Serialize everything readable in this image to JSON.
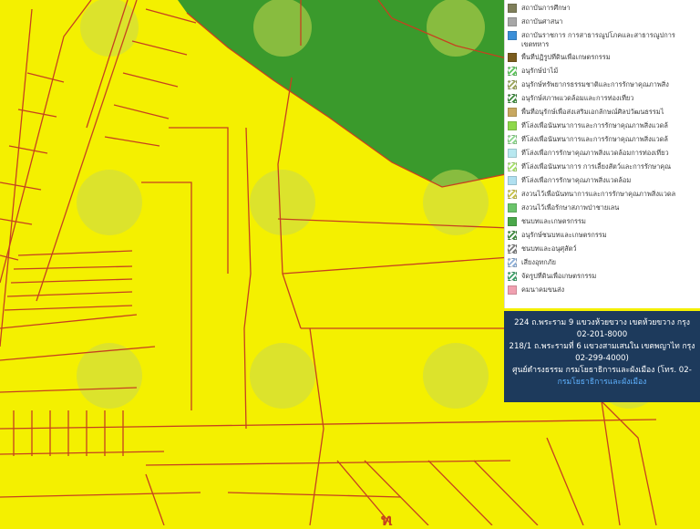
{
  "colors": {
    "zone_yellow": "#f4f000",
    "zone_green": "#3a9a2c",
    "parcel_line": "#c6411f",
    "watermark": "#c9d850",
    "info_bg": "#1d3a5c"
  },
  "legend": {
    "items": [
      {
        "label": "สถาบันการศึกษา",
        "swatch": "#7f7f5a",
        "pattern": "solid"
      },
      {
        "label": "สถาบันศาสนา",
        "swatch": "#a7a7a7",
        "pattern": "solid"
      },
      {
        "label": "สถาบันราชการ การสาธารณูปโภคและสาธารณูปการ",
        "label2": "เขตทหาร",
        "swatch": "#3b8fd8",
        "pattern": "solid"
      },
      {
        "label": "พื้นที่ปฏิรูปที่ดินเพื่อเกษตรกรรม",
        "swatch": "#7a5c1e",
        "pattern": "solid"
      },
      {
        "label": "อนุรักษ์ป่าไม้",
        "swatch": "#5cc45c",
        "pattern": "hatch-green"
      },
      {
        "label": "อนุรักษ์ทรัพยากรธรรมชาติและการรักษาคุณภาพสิ่ง",
        "swatch": "#9aa35a",
        "pattern": "hatch-olive"
      },
      {
        "label": "อนุรักษ์สภาพแวดล้อมและการท่องเที่ยว",
        "swatch": "#3f8a3f",
        "pattern": "hatch-dark"
      },
      {
        "label": "พื้นที่อนุรักษ์เพื่อส่งเสริมเอกลักษณ์ศิลปวัฒนธรรมไ",
        "swatch": "#c8a860",
        "pattern": "solid"
      },
      {
        "label": "ที่โล่งเพื่อนันทนาการและการรักษาคุณภาพสิ่งแวดล้",
        "swatch": "#8ed84a",
        "pattern": "solid"
      },
      {
        "label": "ที่โล่งเพื่อนันทนาการและการรักษาคุณภาพสิ่งแวดล้",
        "swatch": "#8ed88e",
        "pattern": "hatch-light"
      },
      {
        "label": "ที่โล่งเพื่อการรักษาคุณภาพสิ่งแวดล้อมการท่องเที่ยว",
        "swatch": "#b8e8f0",
        "pattern": "solid"
      },
      {
        "label": "ที่โล่งเพื่อนันทนาการ การเลี้ยงสัตว์และการรักษาคุณ",
        "swatch": "#a6e06a",
        "pattern": "hatch-lime"
      },
      {
        "label": "ที่โล่งเพื่อการรักษาคุณภาพสิ่งแวดล้อม",
        "swatch": "#b0e0f0",
        "pattern": "solid"
      },
      {
        "label": "สงวนไว้เพื่อนันทนาการและการรักษาคุณภาพสิ่งแวดล",
        "swatch": "#c6c04a",
        "pattern": "hatch-yellow"
      },
      {
        "label": "สงวนไว้เพื่อรักษาสภาพป่าชายเลน",
        "swatch": "#6ac46a",
        "pattern": "solid"
      },
      {
        "label": "ชนบทและเกษตรกรรม",
        "swatch": "#4aa84a",
        "pattern": "solid"
      },
      {
        "label": "อนุรักษ์ชนบทและเกษตรกรรม",
        "swatch": "#3a9a3a",
        "pattern": "hatch-dark"
      },
      {
        "label": "ชนบทและอนุศุสัตว์",
        "swatch": "#7a7a7a",
        "pattern": "hatch-gray"
      },
      {
        "label": "เสี่ยงอุทกภัย",
        "swatch": "#8fb0d8",
        "pattern": "hatch-blue"
      },
      {
        "label": "จัดรูปที่ดินเพื่อเกษตรกรรม",
        "swatch": "#3fa06a",
        "pattern": "hatch-red"
      },
      {
        "label": "คมนาคมขนส่ง",
        "swatch": "#f0a0b0",
        "pattern": "solid"
      }
    ]
  },
  "info": {
    "line1": "224 ถ.พระราม 9 แขวงห้วยขวาง เขตห้วยขวาง กรุง",
    "line2": "02-201-8000",
    "line3": "218/1 ถ.พระรามที่ 6 แขวงสามเสนใน เขตพญาไท กรุง",
    "line4": "02-299-4000)",
    "line5": "ศูนย์ดำรงธรรม กรมโยธาธิการและผังเมือง (โทร. 02-",
    "link": "กรมโยธาธิการและผังเมือง"
  },
  "map": {
    "bottom_fragment": "ท"
  }
}
